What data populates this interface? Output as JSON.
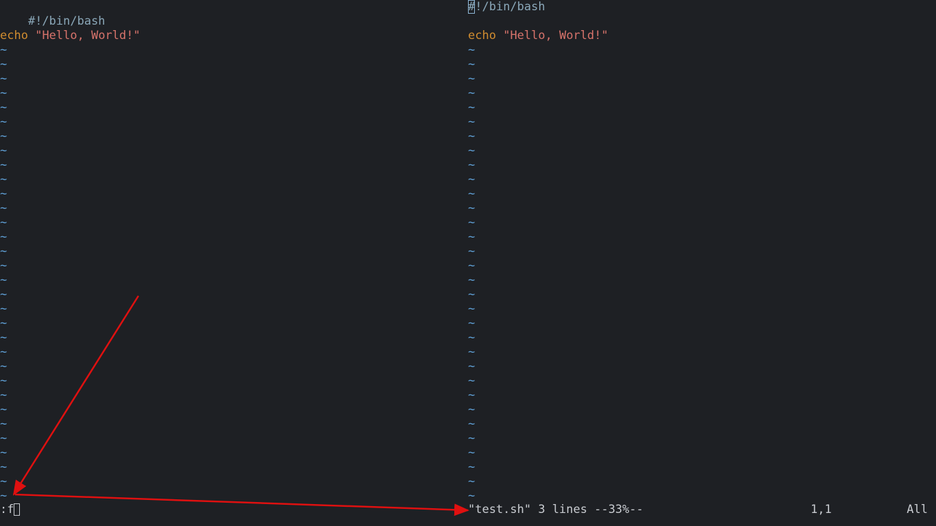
{
  "left_pane": {
    "lines": [
      {
        "kind": "shebang",
        "text": "#!/bin/bash"
      },
      {
        "kind": "blank",
        "text": ""
      },
      {
        "kind": "echo",
        "kw": "echo",
        "str": "\"Hello, World!\""
      }
    ],
    "tilde_count": 32,
    "tilde": "~"
  },
  "right_pane": {
    "cursor_char": "#",
    "shebang_rest": "!/bin/bash",
    "lines": [
      {
        "kind": "shebang",
        "text": "#!/bin/bash"
      },
      {
        "kind": "blank",
        "text": ""
      },
      {
        "kind": "echo",
        "kw": "echo",
        "str": "\"Hello, World!\""
      }
    ],
    "tilde_count": 32,
    "tilde": "~"
  },
  "command_line": {
    "text": ":f"
  },
  "status": {
    "file_info": "\"test.sh\" 3 lines --33%--",
    "position": "1,1",
    "scroll": "All"
  },
  "annotation": {
    "color": "#e01010"
  }
}
